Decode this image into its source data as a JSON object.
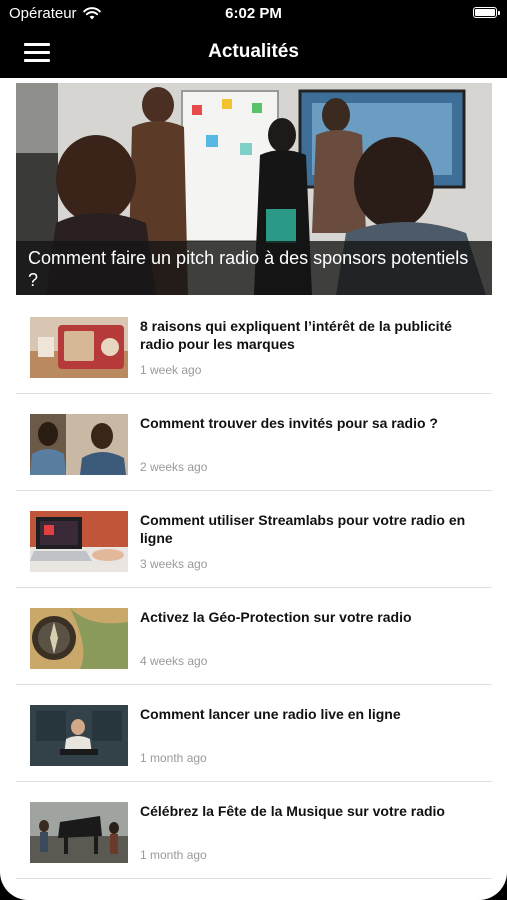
{
  "status_bar": {
    "carrier": "Opérateur",
    "time": "6:02 PM",
    "icons": [
      "wifi-icon",
      "battery-icon"
    ]
  },
  "nav": {
    "title": "Actualités",
    "menu_icon": "hamburger-menu-icon"
  },
  "featured": {
    "title": "Comment faire un pitch radio à des sponsors potentiels ?"
  },
  "articles": [
    {
      "title": "8 raisons qui expliquent l’intérêt de la publicité radio pour les marques",
      "date": "1 week ago"
    },
    {
      "title": "Comment trouver des invités pour sa radio ?",
      "date": "2 weeks ago"
    },
    {
      "title": "Comment utiliser Streamlabs pour votre radio en ligne",
      "date": "3 weeks ago"
    },
    {
      "title": "Activez la Géo-Protection sur votre radio",
      "date": "4 weeks ago"
    },
    {
      "title": "Comment lancer une radio live en ligne",
      "date": "1 month ago"
    },
    {
      "title": "Célébrez la Fête de la Musique sur votre radio",
      "date": "1 month ago"
    }
  ],
  "colors": {
    "header_bg": "#000000",
    "content_bg": "#ffffff",
    "date_text": "#9a9a9a",
    "divider": "#dedede"
  }
}
